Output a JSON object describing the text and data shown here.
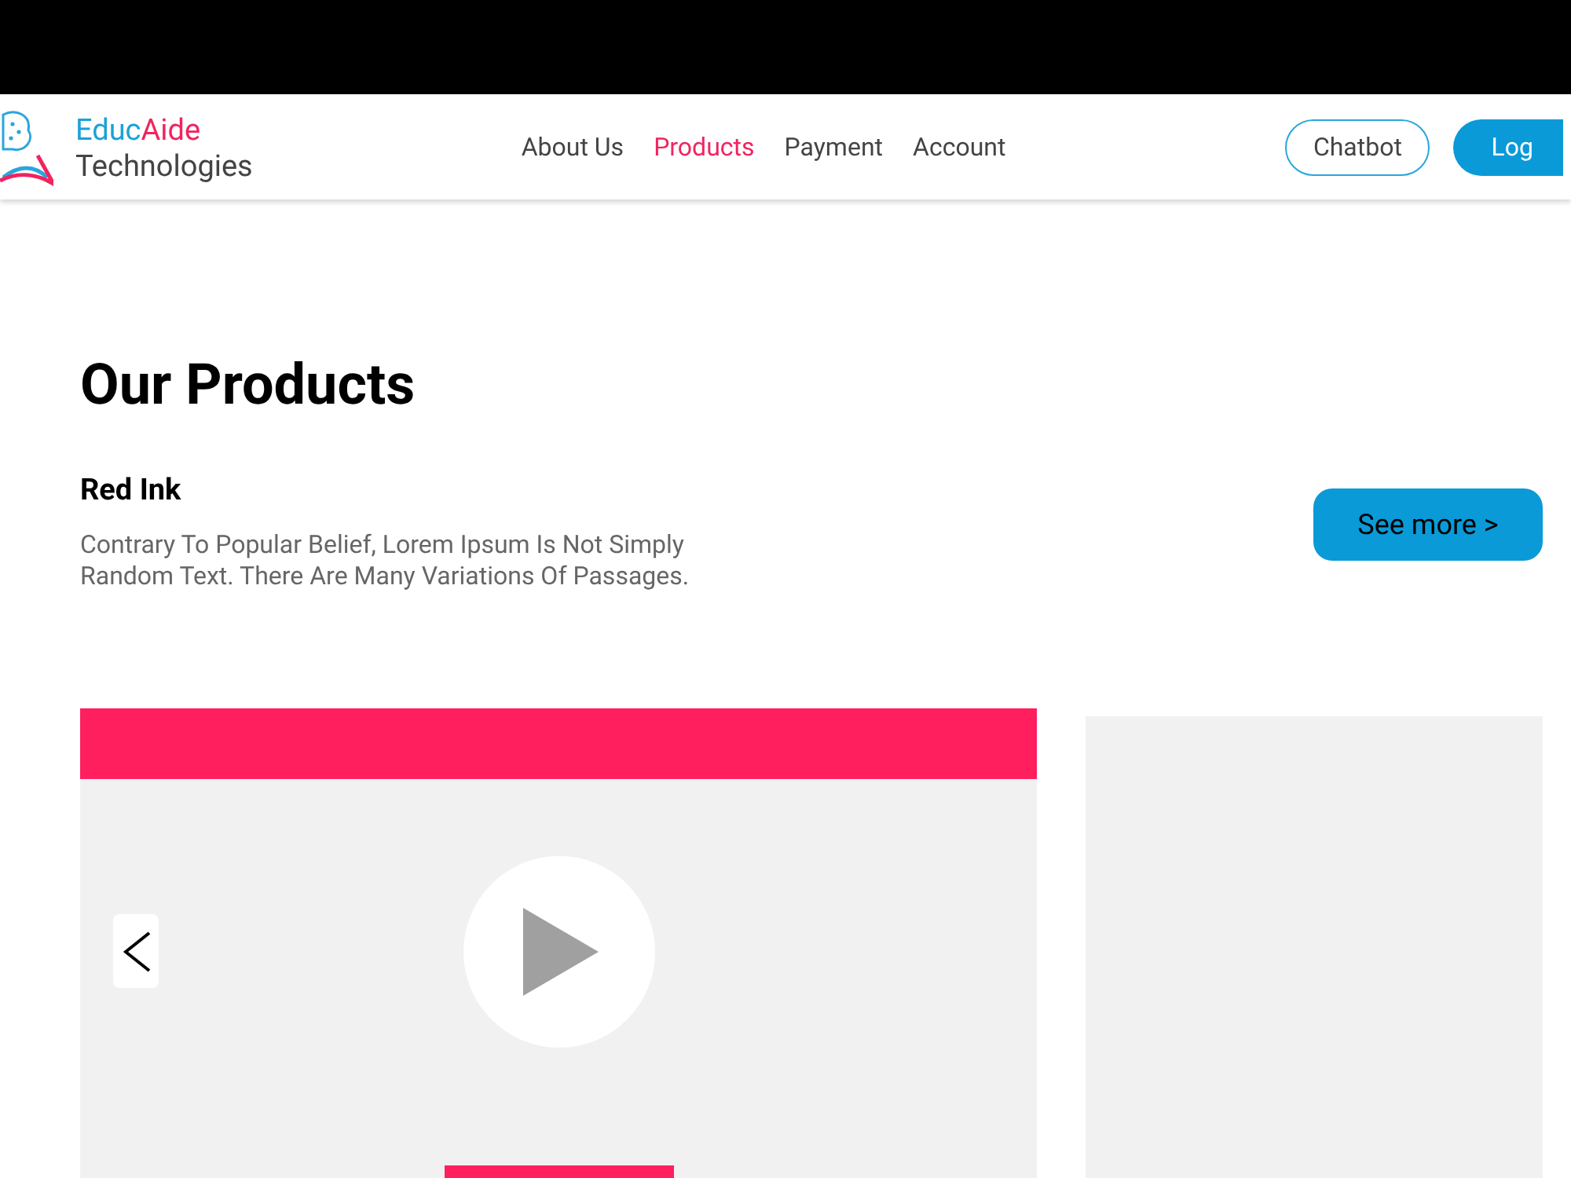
{
  "brand": {
    "name_part_1": "Educ",
    "name_part_2": "Aide",
    "subtitle": "Technologies"
  },
  "nav": [
    {
      "label": "About Us",
      "selected": false
    },
    {
      "label": "Products",
      "selected": true
    },
    {
      "label": "Payment",
      "selected": false
    },
    {
      "label": "Account",
      "selected": false
    }
  ],
  "actions": {
    "chatbot": "Chatbot",
    "login": "Log"
  },
  "section": {
    "title": "Our Products"
  },
  "product": {
    "name": "Red Ink",
    "description": "Contrary To Popular Belief, Lorem Ipsum Is Not Simply Random Text. There Are Many Variations Of Passages.",
    "button": "See more >"
  }
}
